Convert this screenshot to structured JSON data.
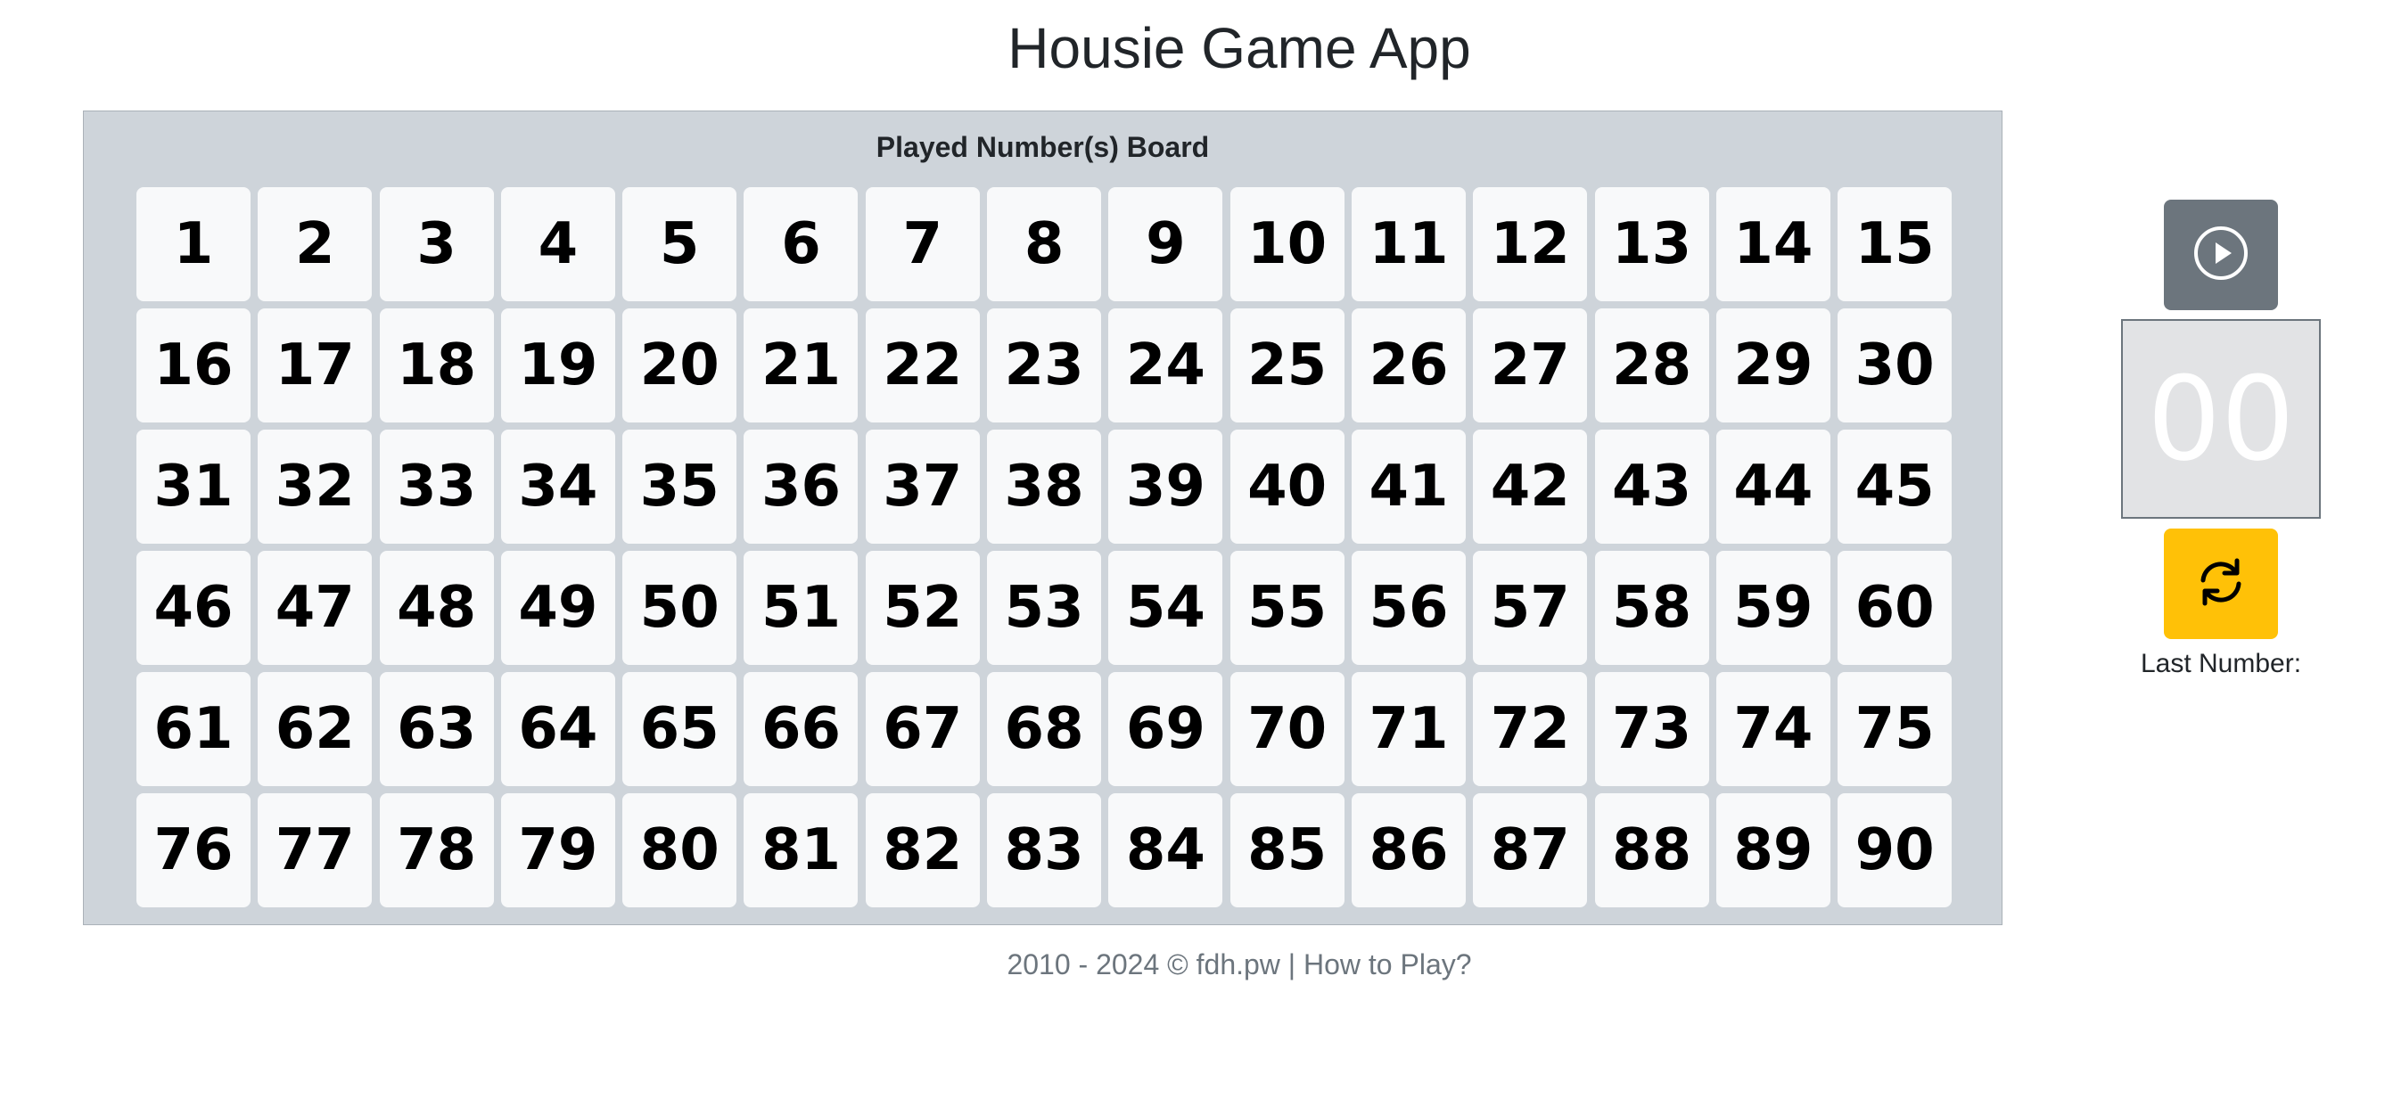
{
  "app": {
    "title": "Housie Game App"
  },
  "board": {
    "title": "Played Number(s) Board",
    "numbers": [
      "1",
      "2",
      "3",
      "4",
      "5",
      "6",
      "7",
      "8",
      "9",
      "10",
      "11",
      "12",
      "13",
      "14",
      "15",
      "16",
      "17",
      "18",
      "19",
      "20",
      "21",
      "22",
      "23",
      "24",
      "25",
      "26",
      "27",
      "28",
      "29",
      "30",
      "31",
      "32",
      "33",
      "34",
      "35",
      "36",
      "37",
      "38",
      "39",
      "40",
      "41",
      "42",
      "43",
      "44",
      "45",
      "46",
      "47",
      "48",
      "49",
      "50",
      "51",
      "52",
      "53",
      "54",
      "55",
      "56",
      "57",
      "58",
      "59",
      "60",
      "61",
      "62",
      "63",
      "64",
      "65",
      "66",
      "67",
      "68",
      "69",
      "70",
      "71",
      "72",
      "73",
      "74",
      "75",
      "76",
      "77",
      "78",
      "79",
      "80",
      "81",
      "82",
      "83",
      "84",
      "85",
      "86",
      "87",
      "88",
      "89",
      "90"
    ]
  },
  "controls": {
    "play_icon": "play-circle-icon",
    "current_number": "00",
    "refresh_icon": "refresh-icon",
    "last_number_label": "Last Number:"
  },
  "footer": {
    "copyright": "2010 - 2024 © fdh.pw",
    "separator": " | ",
    "how_to_play": "How to Play?"
  },
  "colors": {
    "board_bg": "#ced4da",
    "cell_bg": "#f8f9fa",
    "play_button": "#6c757d",
    "refresh_button": "#ffc107",
    "current_box_bg": "#e2e3e5"
  }
}
